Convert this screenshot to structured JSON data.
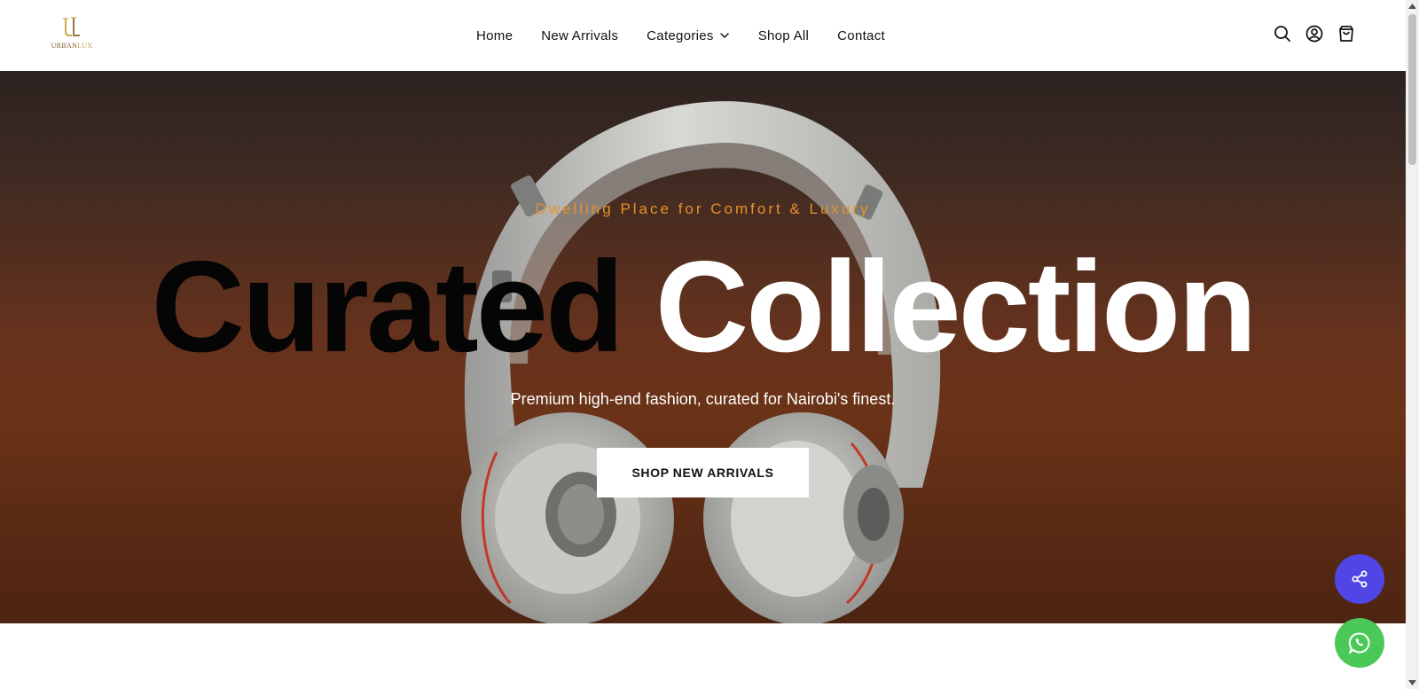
{
  "brand": {
    "logo_monogram": "UL",
    "logo_text_main": "URBAN",
    "logo_text_accent": "LUX"
  },
  "nav": {
    "items": [
      {
        "label": "Home"
      },
      {
        "label": "New Arrivals"
      },
      {
        "label": "Categories",
        "has_dropdown": true
      },
      {
        "label": "Shop All"
      },
      {
        "label": "Contact"
      }
    ]
  },
  "header_icons": [
    "search-icon",
    "account-icon",
    "cart-icon"
  ],
  "hero": {
    "eyebrow": "Dwelling Place for Comfort & Luxury",
    "title_dark": "Curated",
    "title_light": "Collection",
    "subtitle": "Premium high-end fashion, curated for Nairobi's finest.",
    "cta_label": "SHOP NEW ARRIVALS"
  },
  "floating_buttons": [
    "share-icon",
    "whatsapp-icon"
  ],
  "colors": {
    "accent_orange": "#e6922a",
    "share_fab": "#4f46e5",
    "whatsapp_fab": "#4ac959",
    "logo_gold": "#c99a3c"
  }
}
